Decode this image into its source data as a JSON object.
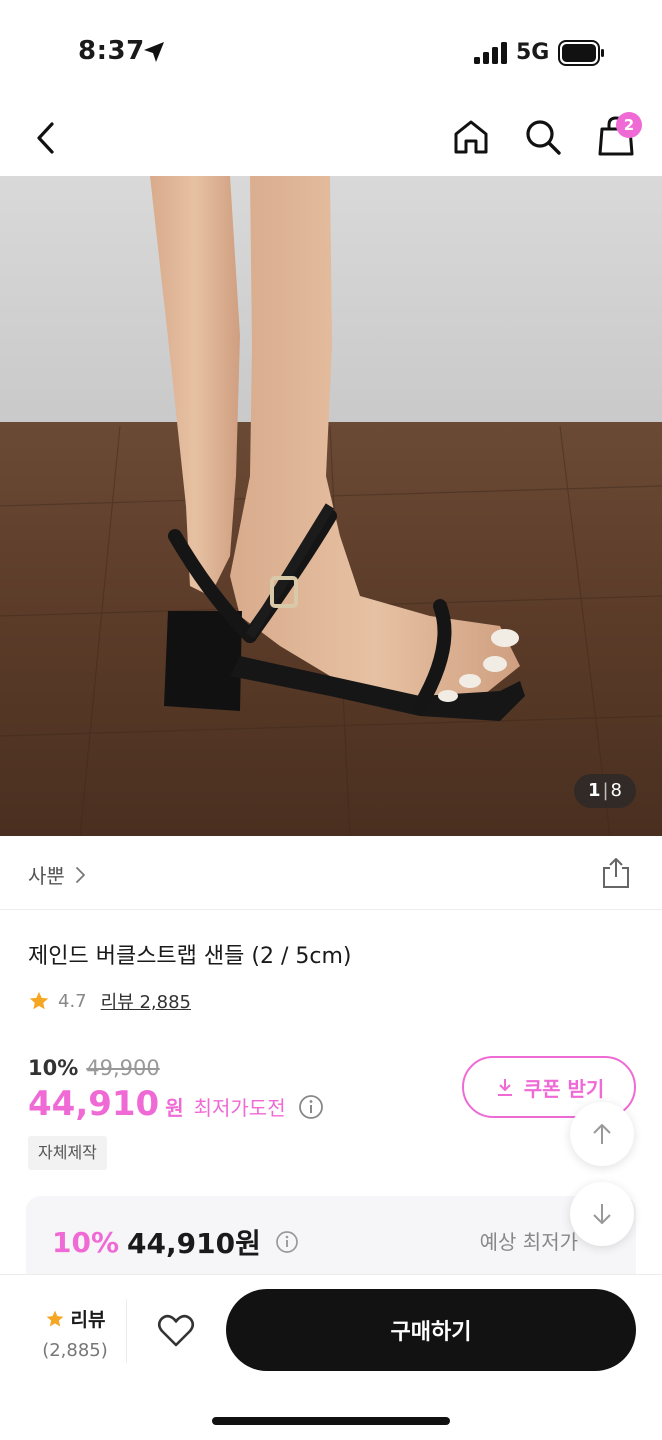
{
  "status_bar": {
    "time": "8:37",
    "network": "5G"
  },
  "nav": {
    "cart_count": "2"
  },
  "hero": {
    "current": "1",
    "separator": "|",
    "total": "8"
  },
  "brand": {
    "name": "사뿐"
  },
  "product": {
    "title": "제인드 버클스트랩 샌들 (2 / 5cm)",
    "rating": "4.7",
    "review_link": "리뷰 2,885"
  },
  "price": {
    "discount_rate": "10%",
    "original": "49,900",
    "sale": "44,910",
    "unit": "원",
    "lowest_label": "최저가도전",
    "coupon_label": "쿠폰 받기",
    "tag": "자체제작"
  },
  "best_price": {
    "rate": "10%",
    "price": "44,910원",
    "label": "예상 최저가"
  },
  "bottom_bar": {
    "review_label": "리뷰",
    "review_count": "(2,885)",
    "buy_label": "구매하기"
  },
  "colors": {
    "accent": "#f06ad6",
    "buy_button": "#121212",
    "star": "#f5a623"
  }
}
